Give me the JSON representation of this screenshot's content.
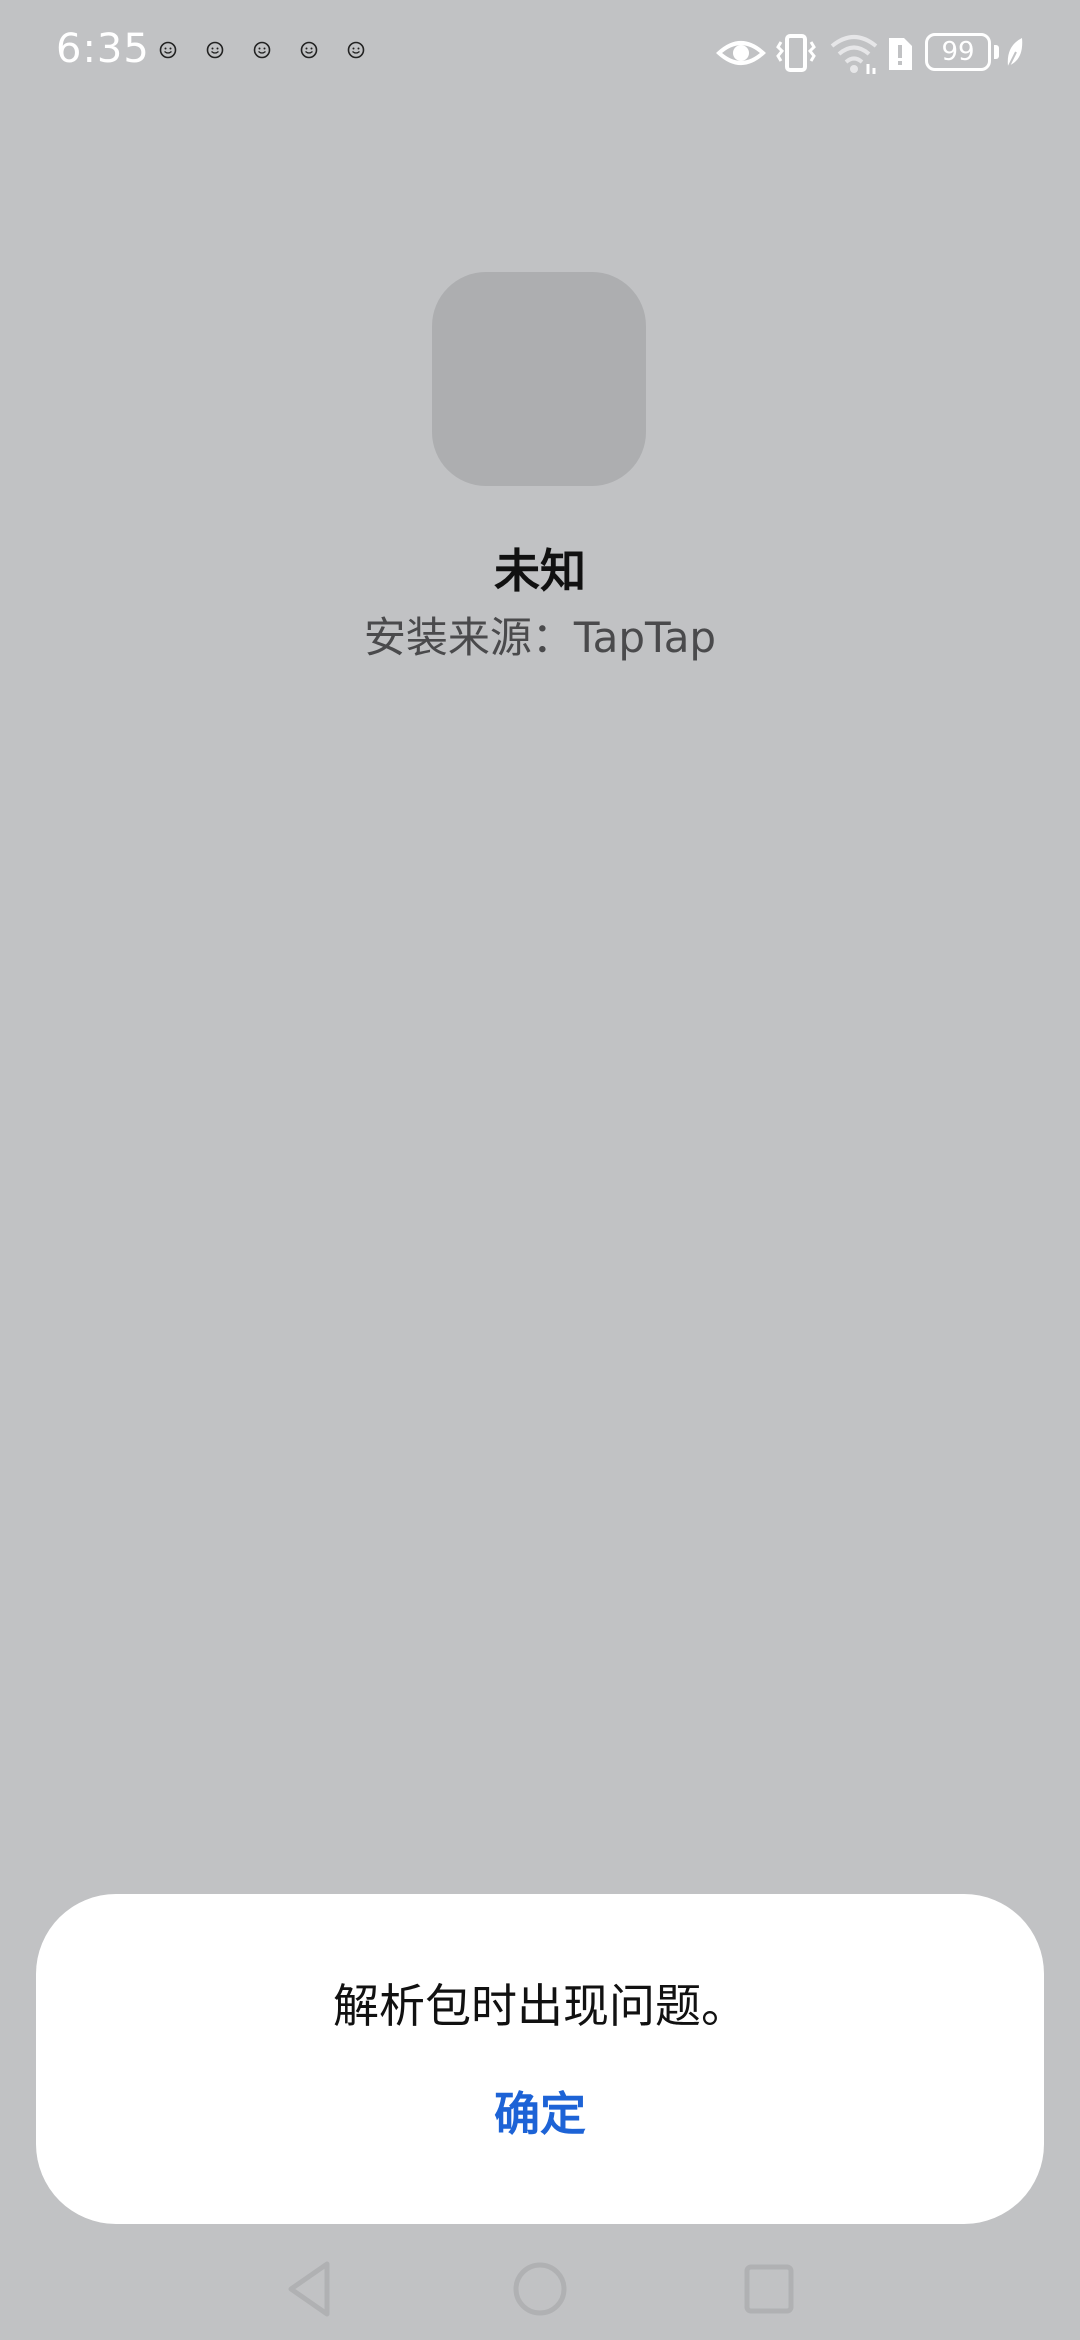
{
  "status_bar": {
    "time": "6:35",
    "notification_icons": [
      "smiley-icon",
      "smiley-icon",
      "smiley-icon",
      "smiley-icon",
      "smiley-icon"
    ],
    "right_icons": [
      "eye-icon",
      "vibrate-icon",
      "wifi-icon",
      "sim-alert-icon",
      "battery-icon",
      "leaf-icon"
    ],
    "battery_level": "99"
  },
  "app": {
    "name": "未知",
    "install_source": "安装来源：TapTap"
  },
  "dialog": {
    "message": "解析包时出现问题。",
    "confirm_label": "确定"
  },
  "nav_bar": {
    "buttons": [
      "back-icon",
      "home-icon",
      "recents-icon"
    ]
  },
  "colors": {
    "background": "#c1c2c4",
    "accent": "#1d63d6",
    "dialog": "#ffffff"
  }
}
